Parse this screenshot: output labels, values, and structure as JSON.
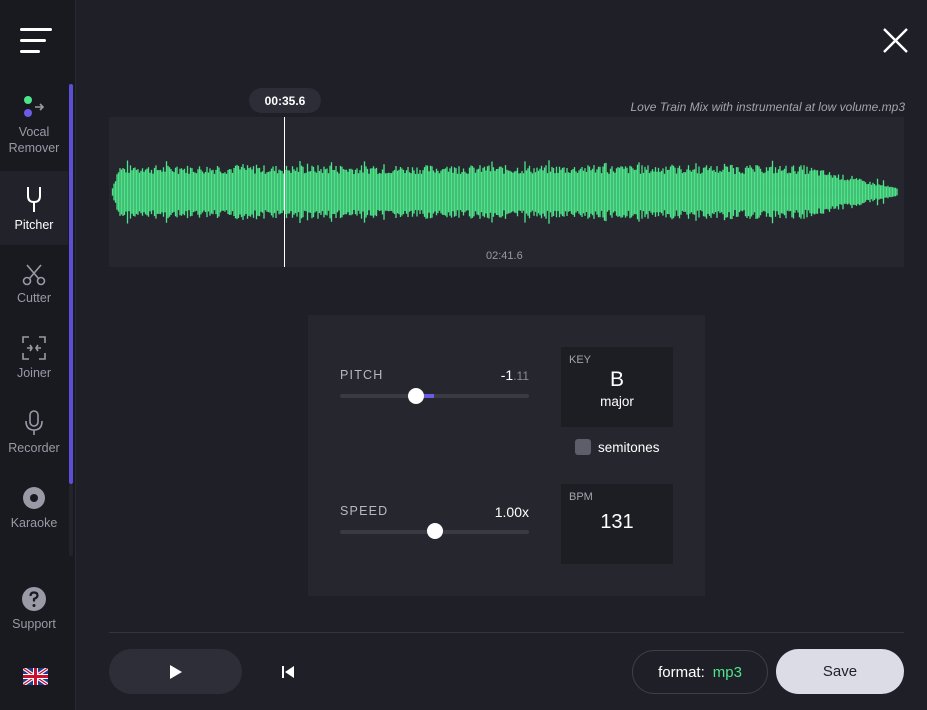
{
  "sidebar": {
    "items": [
      {
        "label_line1": "Vocal",
        "label_line2": "Remover",
        "icon": "vocal-remover-icon"
      },
      {
        "label": "Pitcher",
        "icon": "tuning-fork-icon",
        "active": true
      },
      {
        "label": "Cutter",
        "icon": "scissors-icon"
      },
      {
        "label": "Joiner",
        "icon": "joiner-icon"
      },
      {
        "label": "Recorder",
        "icon": "microphone-icon"
      },
      {
        "label": "Karaoke",
        "icon": "disc-icon"
      }
    ],
    "support_label": "Support",
    "language_icon": "uk-flag-icon"
  },
  "waveform": {
    "file_name": "Love Train Mix with instrumental at low volume.mp3",
    "current_time": "00:35.6",
    "duration": "02:41.6",
    "color": "#4de589"
  },
  "controls": {
    "pitch": {
      "label": "PITCH",
      "value_int": "-1",
      "value_dec": ".11",
      "fraction": 0.4
    },
    "speed": {
      "label": "SPEED",
      "value": "1.00x",
      "fraction": 0.5
    },
    "key": {
      "label": "KEY",
      "note": "B",
      "mode": "major"
    },
    "semitones_label": "semitones",
    "bpm": {
      "label": "BPM",
      "value": "131"
    }
  },
  "bottom": {
    "format_label": "format:",
    "format_value": "mp3",
    "save_label": "Save"
  },
  "colors": {
    "accent": "#6b5ce7",
    "waveform": "#4de589",
    "background": "#1f1f27"
  }
}
